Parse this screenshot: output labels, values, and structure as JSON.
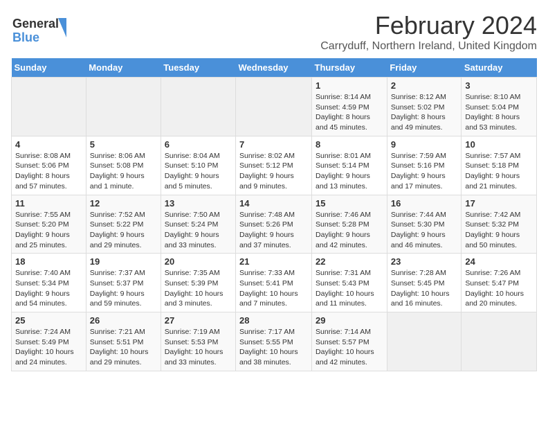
{
  "header": {
    "logo_general": "General",
    "logo_blue": "Blue",
    "main_title": "February 2024",
    "subtitle": "Carryduff, Northern Ireland, United Kingdom"
  },
  "days_of_week": [
    "Sunday",
    "Monday",
    "Tuesday",
    "Wednesday",
    "Thursday",
    "Friday",
    "Saturday"
  ],
  "weeks": [
    [
      {
        "day": "",
        "info": ""
      },
      {
        "day": "",
        "info": ""
      },
      {
        "day": "",
        "info": ""
      },
      {
        "day": "",
        "info": ""
      },
      {
        "day": "1",
        "info": "Sunrise: 8:14 AM\nSunset: 4:59 PM\nDaylight: 8 hours\nand 45 minutes."
      },
      {
        "day": "2",
        "info": "Sunrise: 8:12 AM\nSunset: 5:02 PM\nDaylight: 8 hours\nand 49 minutes."
      },
      {
        "day": "3",
        "info": "Sunrise: 8:10 AM\nSunset: 5:04 PM\nDaylight: 8 hours\nand 53 minutes."
      }
    ],
    [
      {
        "day": "4",
        "info": "Sunrise: 8:08 AM\nSunset: 5:06 PM\nDaylight: 8 hours\nand 57 minutes."
      },
      {
        "day": "5",
        "info": "Sunrise: 8:06 AM\nSunset: 5:08 PM\nDaylight: 9 hours\nand 1 minute."
      },
      {
        "day": "6",
        "info": "Sunrise: 8:04 AM\nSunset: 5:10 PM\nDaylight: 9 hours\nand 5 minutes."
      },
      {
        "day": "7",
        "info": "Sunrise: 8:02 AM\nSunset: 5:12 PM\nDaylight: 9 hours\nand 9 minutes."
      },
      {
        "day": "8",
        "info": "Sunrise: 8:01 AM\nSunset: 5:14 PM\nDaylight: 9 hours\nand 13 minutes."
      },
      {
        "day": "9",
        "info": "Sunrise: 7:59 AM\nSunset: 5:16 PM\nDaylight: 9 hours\nand 17 minutes."
      },
      {
        "day": "10",
        "info": "Sunrise: 7:57 AM\nSunset: 5:18 PM\nDaylight: 9 hours\nand 21 minutes."
      }
    ],
    [
      {
        "day": "11",
        "info": "Sunrise: 7:55 AM\nSunset: 5:20 PM\nDaylight: 9 hours\nand 25 minutes."
      },
      {
        "day": "12",
        "info": "Sunrise: 7:52 AM\nSunset: 5:22 PM\nDaylight: 9 hours\nand 29 minutes."
      },
      {
        "day": "13",
        "info": "Sunrise: 7:50 AM\nSunset: 5:24 PM\nDaylight: 9 hours\nand 33 minutes."
      },
      {
        "day": "14",
        "info": "Sunrise: 7:48 AM\nSunset: 5:26 PM\nDaylight: 9 hours\nand 37 minutes."
      },
      {
        "day": "15",
        "info": "Sunrise: 7:46 AM\nSunset: 5:28 PM\nDaylight: 9 hours\nand 42 minutes."
      },
      {
        "day": "16",
        "info": "Sunrise: 7:44 AM\nSunset: 5:30 PM\nDaylight: 9 hours\nand 46 minutes."
      },
      {
        "day": "17",
        "info": "Sunrise: 7:42 AM\nSunset: 5:32 PM\nDaylight: 9 hours\nand 50 minutes."
      }
    ],
    [
      {
        "day": "18",
        "info": "Sunrise: 7:40 AM\nSunset: 5:34 PM\nDaylight: 9 hours\nand 54 minutes."
      },
      {
        "day": "19",
        "info": "Sunrise: 7:37 AM\nSunset: 5:37 PM\nDaylight: 9 hours\nand 59 minutes."
      },
      {
        "day": "20",
        "info": "Sunrise: 7:35 AM\nSunset: 5:39 PM\nDaylight: 10 hours\nand 3 minutes."
      },
      {
        "day": "21",
        "info": "Sunrise: 7:33 AM\nSunset: 5:41 PM\nDaylight: 10 hours\nand 7 minutes."
      },
      {
        "day": "22",
        "info": "Sunrise: 7:31 AM\nSunset: 5:43 PM\nDaylight: 10 hours\nand 11 minutes."
      },
      {
        "day": "23",
        "info": "Sunrise: 7:28 AM\nSunset: 5:45 PM\nDaylight: 10 hours\nand 16 minutes."
      },
      {
        "day": "24",
        "info": "Sunrise: 7:26 AM\nSunset: 5:47 PM\nDaylight: 10 hours\nand 20 minutes."
      }
    ],
    [
      {
        "day": "25",
        "info": "Sunrise: 7:24 AM\nSunset: 5:49 PM\nDaylight: 10 hours\nand 24 minutes."
      },
      {
        "day": "26",
        "info": "Sunrise: 7:21 AM\nSunset: 5:51 PM\nDaylight: 10 hours\nand 29 minutes."
      },
      {
        "day": "27",
        "info": "Sunrise: 7:19 AM\nSunset: 5:53 PM\nDaylight: 10 hours\nand 33 minutes."
      },
      {
        "day": "28",
        "info": "Sunrise: 7:17 AM\nSunset: 5:55 PM\nDaylight: 10 hours\nand 38 minutes."
      },
      {
        "day": "29",
        "info": "Sunrise: 7:14 AM\nSunset: 5:57 PM\nDaylight: 10 hours\nand 42 minutes."
      },
      {
        "day": "",
        "info": ""
      },
      {
        "day": "",
        "info": ""
      }
    ]
  ]
}
